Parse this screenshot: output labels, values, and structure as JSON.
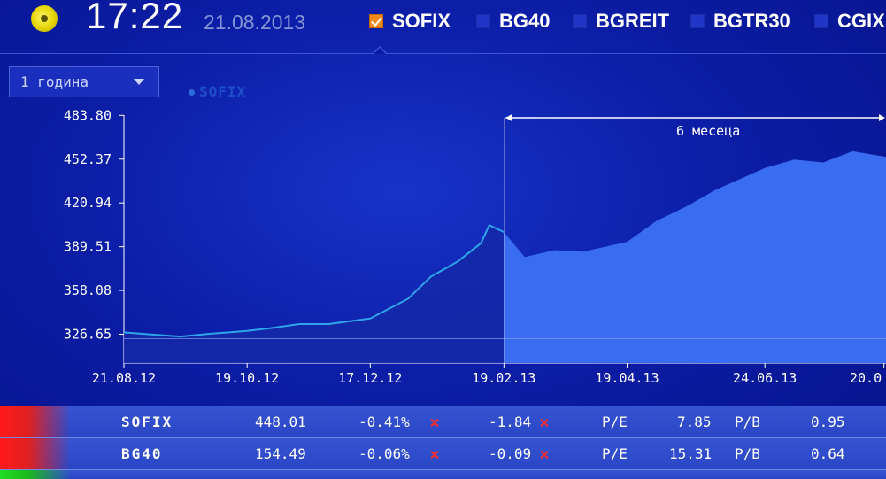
{
  "header": {
    "time": "17:22",
    "date": "21.08.2013",
    "tabs": [
      {
        "label": "SOFIX",
        "checked": true
      },
      {
        "label": "BG40",
        "checked": false
      },
      {
        "label": "BGREIT",
        "checked": false
      },
      {
        "label": "BGTR30",
        "checked": false
      },
      {
        "label": "CGIX",
        "checked": false
      }
    ]
  },
  "controls": {
    "period": "1 година",
    "legend": "SOFIX"
  },
  "chart_data": {
    "type": "area",
    "series": [
      {
        "name": "SOFIX",
        "x": [
          "21.08.12",
          "03.09.12",
          "17.09.12",
          "01.10.12",
          "19.10.12",
          "30.10.12",
          "13.11.12",
          "27.11.12",
          "17.12.12",
          "04.01.13",
          "15.01.13",
          "28.01.13",
          "08.02.13",
          "12.02.13",
          "19.02.13",
          "01.03.13",
          "15.03.13",
          "29.03.13",
          "19.04.13",
          "03.05.13",
          "17.05.13",
          "31.05.13",
          "24.06.13",
          "08.07.13",
          "22.07.13",
          "05.08.13",
          "21.08.13"
        ],
        "values": [
          328,
          326.5,
          325,
          327,
          329,
          331,
          334,
          334,
          338,
          352,
          368,
          379,
          392,
          405,
          400,
          382,
          387,
          386,
          393,
          408,
          418,
          430,
          446,
          452,
          450,
          458,
          454
        ]
      }
    ],
    "ylim": [
      306,
      484
    ],
    "yticks": [
      "483.80",
      "452.37",
      "420.94",
      "389.51",
      "358.08",
      "326.65"
    ],
    "ytick_values": [
      483.8,
      452.37,
      420.94,
      389.51,
      358.08,
      326.65
    ],
    "xticks": [
      "21.08.12",
      "19.10.12",
      "17.12.12",
      "19.02.13",
      "19.04.13",
      "24.06.13",
      "20.0"
    ],
    "annotation": "6 месеца",
    "grid": false,
    "colors": {
      "recent": "#3a6cf2",
      "older": "#1428a8",
      "line": "#2fa4ea"
    }
  },
  "table": {
    "rows": [
      {
        "name": "SOFIX",
        "value": "448.01",
        "change_pct": "-0.41%",
        "change_abs": "-1.84",
        "pe_label": "P/E",
        "pe": "7.85",
        "pb_label": "P/B",
        "pb": "0.95",
        "indicator_color": "#ff2020"
      },
      {
        "name": "BG40",
        "value": "154.49",
        "change_pct": "-0.06%",
        "change_abs": "-0.09",
        "pe_label": "P/E",
        "pe": "15.31",
        "pb_label": "P/B",
        "pb": "0.64",
        "indicator_color": "#ff2020"
      }
    ],
    "partial_row_indicator_color": "#1fd02a"
  }
}
